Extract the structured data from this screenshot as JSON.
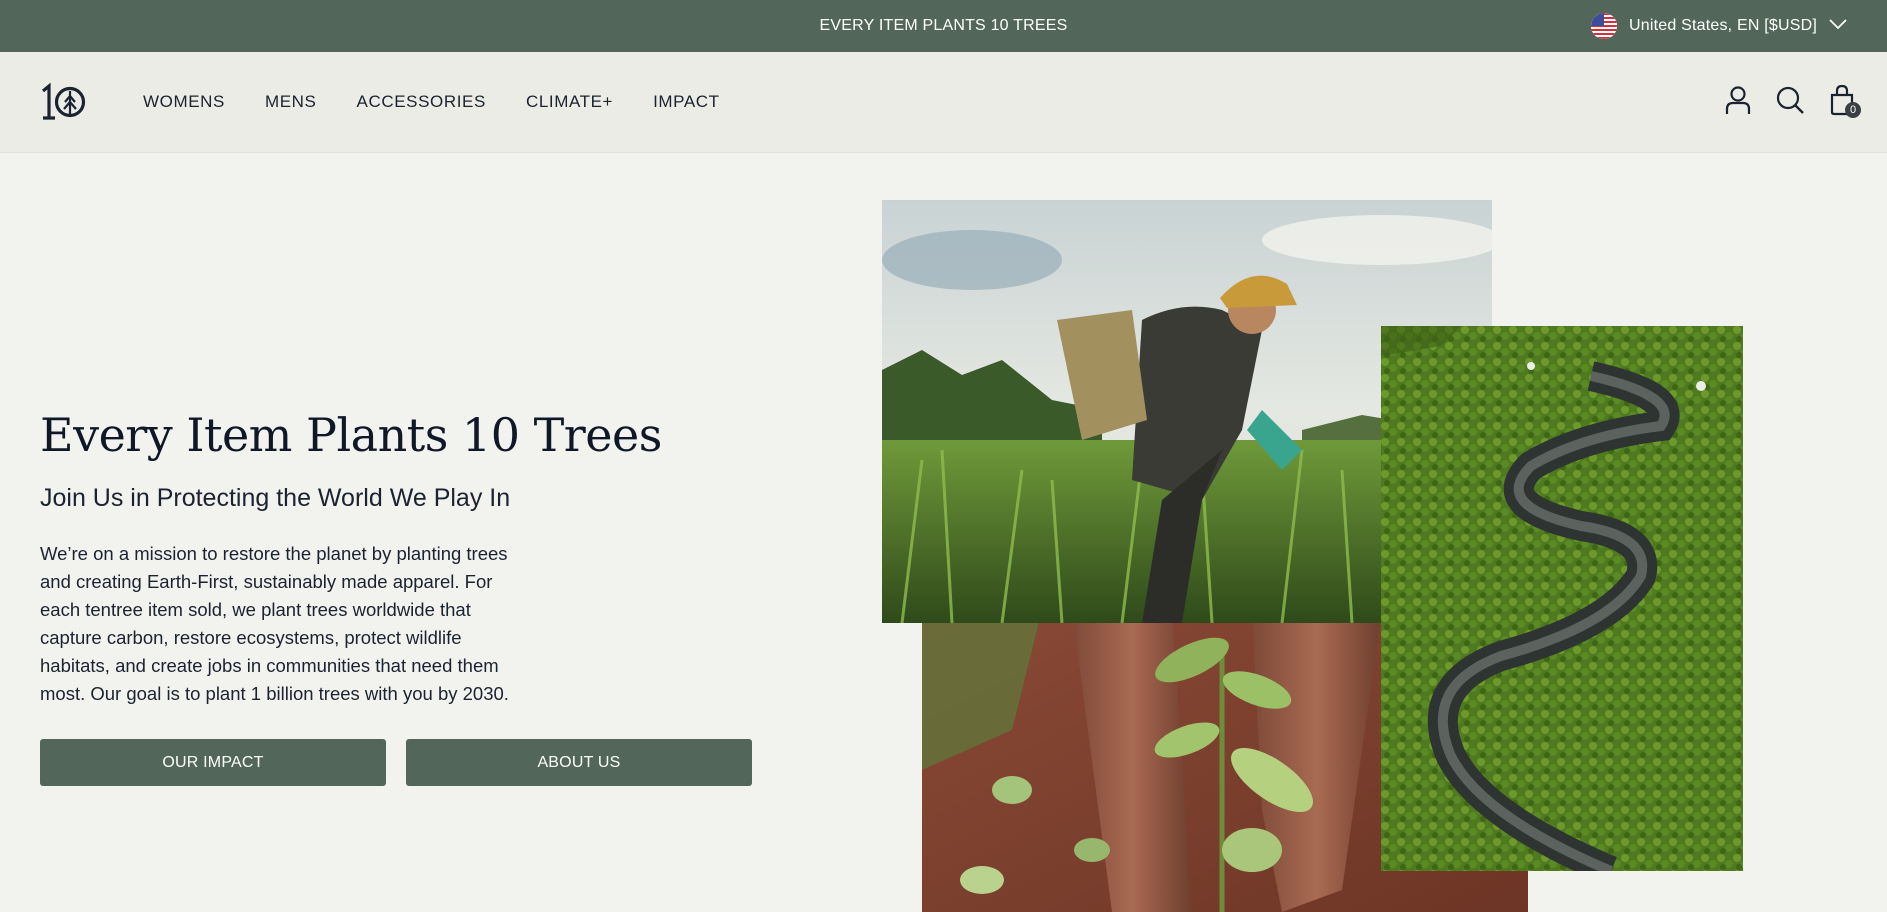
{
  "announcement": {
    "text": "EVERY ITEM PLANTS 10 TREES",
    "region_label": "United States, EN [$USD]",
    "flag_icon": "us-flag-icon",
    "chevron_icon": "chevron-down-icon"
  },
  "header": {
    "logo": "tentree-logo",
    "nav": [
      {
        "label": "WOMENS"
      },
      {
        "label": "MENS"
      },
      {
        "label": "ACCESSORIES"
      },
      {
        "label": "CLIMATE+"
      },
      {
        "label": "IMPACT"
      }
    ],
    "icons": [
      "account-icon",
      "search-icon",
      "cart-icon"
    ],
    "cart_count": "0"
  },
  "hero": {
    "title": "Every Item Plants 10 Trees",
    "subtitle": "Join Us in Protecting the World We Play In",
    "body": "We’re on a mission to restore the planet by planting trees and creating Earth-First, sustainably made apparel. For each tentree item sold, we plant trees worldwide that capture carbon, restore ecosystems, protect wildlife habitats, and create jobs in communities that need them most. Our goal is to plant 1 billion trees with you by 2030.",
    "buttons": [
      {
        "label": "OUR IMPACT"
      },
      {
        "label": "ABOUT US"
      }
    ]
  },
  "colors": {
    "brand_green": "#52665a",
    "page_bg": "#f2f2ef",
    "header_bg": "#ecece7",
    "text": "#1b2330"
  }
}
